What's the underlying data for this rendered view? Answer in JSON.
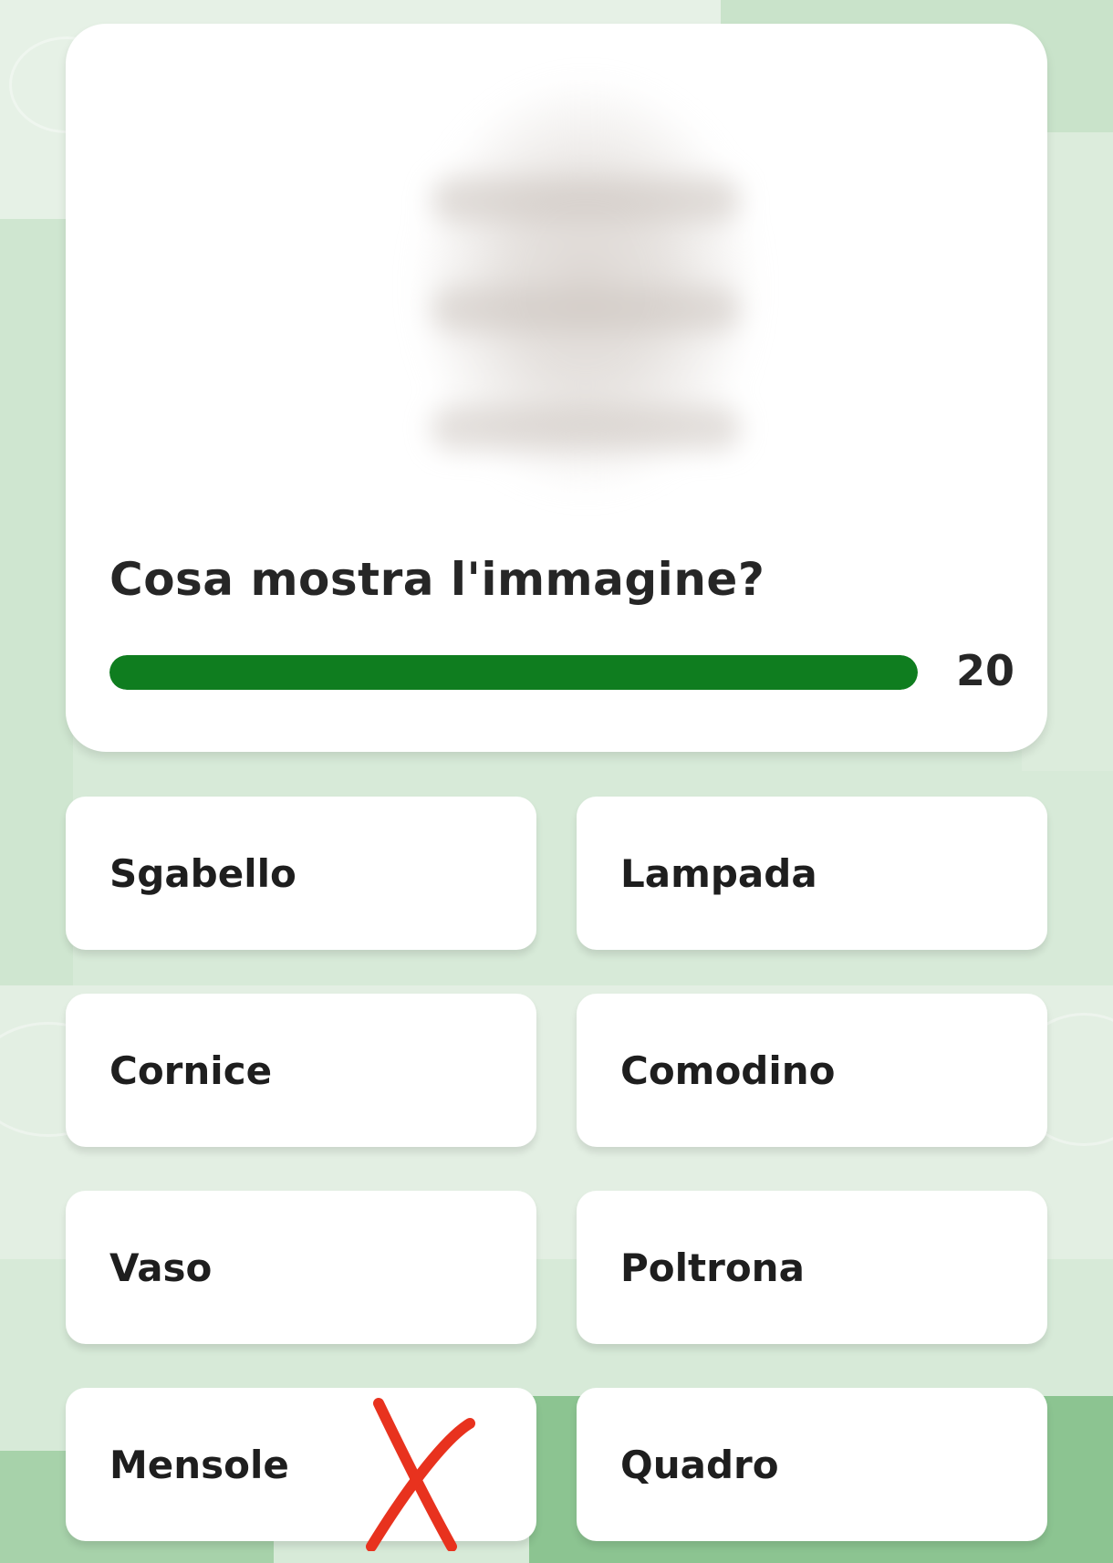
{
  "question": {
    "text": "Cosa mostra l'immagine?",
    "progress_percent": 100,
    "timer": "20"
  },
  "answers": [
    {
      "label": "Sgabello"
    },
    {
      "label": "Lampada"
    },
    {
      "label": "Cornice"
    },
    {
      "label": "Comodino"
    },
    {
      "label": "Vaso"
    },
    {
      "label": "Poltrona"
    },
    {
      "label": "Mensole"
    },
    {
      "label": "Quadro"
    }
  ],
  "colors": {
    "accent": "#0f7d1f",
    "background": "#d7ead8",
    "mark": "#e8321e"
  },
  "annotation": {
    "icon": "cross-mark-icon"
  }
}
